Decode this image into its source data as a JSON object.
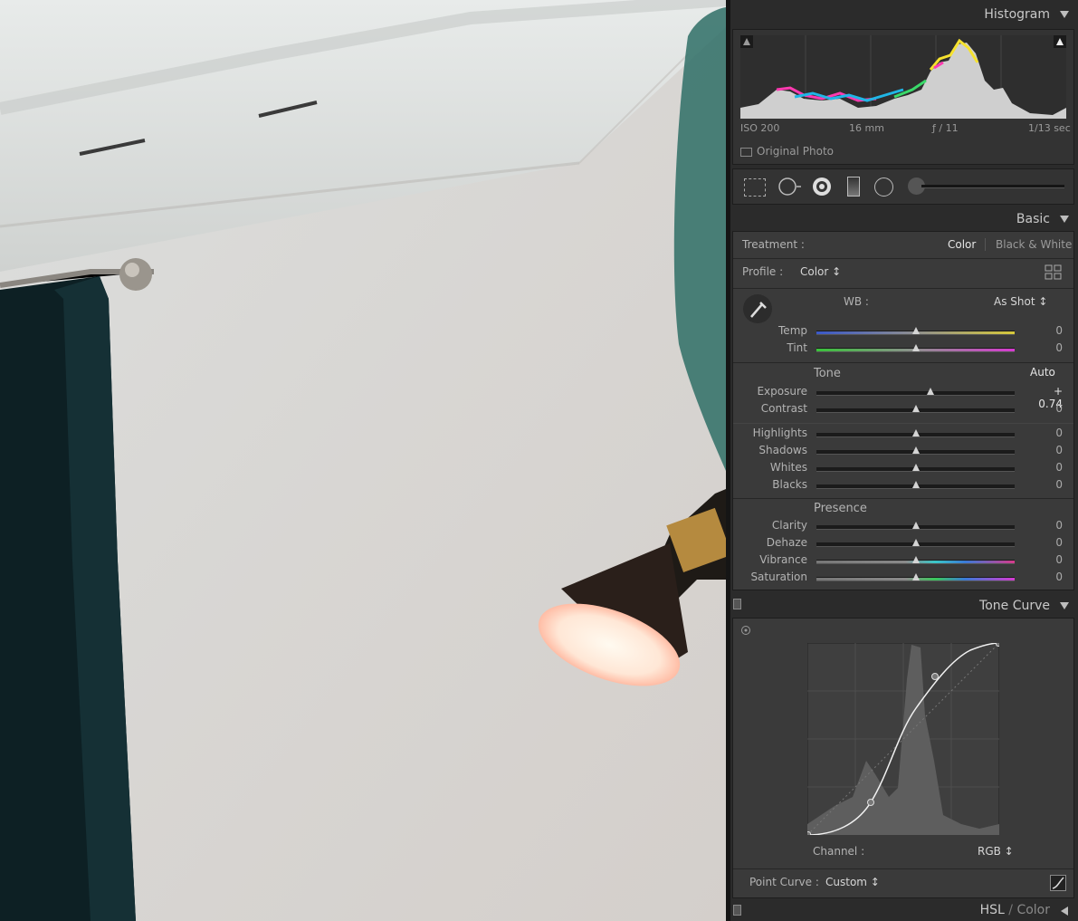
{
  "histogram": {
    "title": "Histogram",
    "iso": "ISO 200",
    "focal": "16 mm",
    "aperture": "ƒ / 11",
    "shutter": "1/13 sec",
    "original_photo": "Original Photo"
  },
  "basic": {
    "title": "Basic",
    "treatment_label": "Treatment :",
    "treatment_color": "Color",
    "treatment_bw": "Black & White",
    "profile_label": "Profile :",
    "profile_value": "Color ↕",
    "wb_label": "WB :",
    "wb_value": "As Shot ↕",
    "temp": {
      "label": "Temp",
      "value": "0"
    },
    "tint": {
      "label": "Tint",
      "value": "0"
    },
    "tone_label": "Tone",
    "auto_label": "Auto",
    "exposure": {
      "label": "Exposure",
      "value": "+ 0.74",
      "level": 0.574
    },
    "contrast": {
      "label": "Contrast",
      "value": "0"
    },
    "highlights": {
      "label": "Highlights",
      "value": "0"
    },
    "shadows": {
      "label": "Shadows",
      "value": "0"
    },
    "whites": {
      "label": "Whites",
      "value": "0"
    },
    "blacks": {
      "label": "Blacks",
      "value": "0"
    },
    "presence_label": "Presence",
    "clarity": {
      "label": "Clarity",
      "value": "0"
    },
    "dehaze": {
      "label": "Dehaze",
      "value": "0"
    },
    "vibrance": {
      "label": "Vibrance",
      "value": "0"
    },
    "saturation": {
      "label": "Saturation",
      "value": "0"
    }
  },
  "tone_curve": {
    "title": "Tone Curve",
    "channel_label": "Channel :",
    "channel_value": "RGB ↕",
    "point_curve_label": "Point Curve :",
    "point_curve_value": "Custom ↕"
  },
  "hsl": {
    "title": "HSL",
    "sep": " / ",
    "color": "Color"
  },
  "colors": {
    "panel": "#2b2b2b",
    "box": "#3a3a3a",
    "accent_text": "#e6e6e6"
  }
}
